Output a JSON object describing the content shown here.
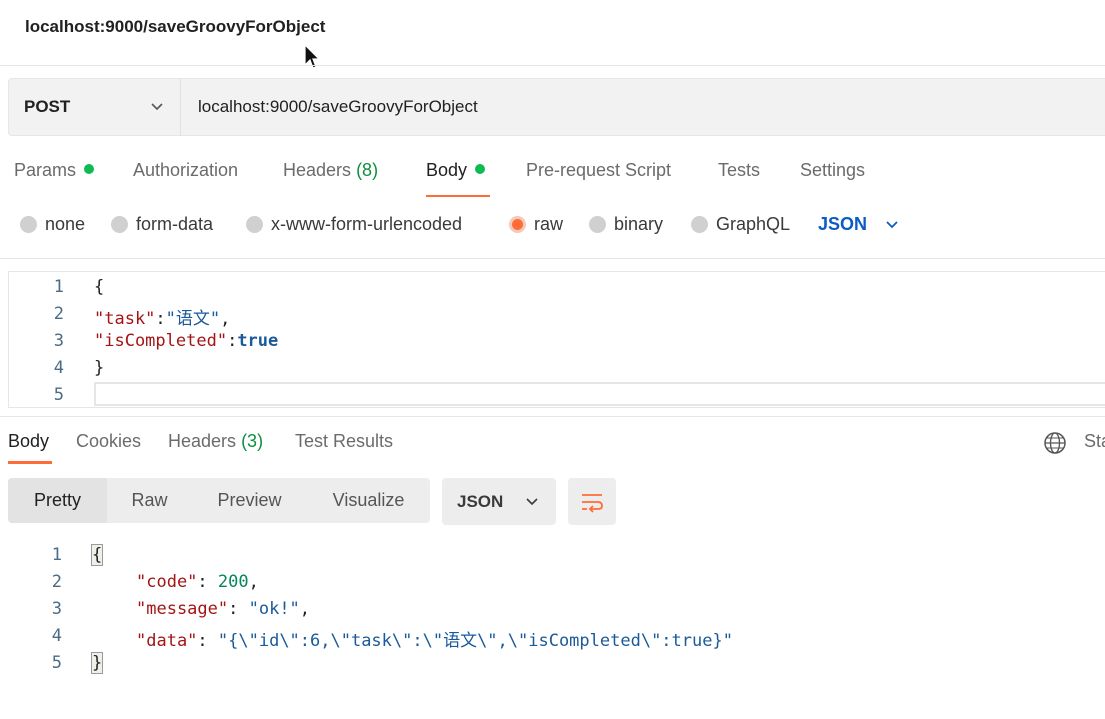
{
  "page_title": "localhost:9000/saveGroovyForObject",
  "request": {
    "method": "POST",
    "url": "localhost:9000/saveGroovyForObject"
  },
  "request_tabs": [
    {
      "label": "Params"
    },
    {
      "label": "Authorization"
    },
    {
      "label": "Headers",
      "count": "(8)"
    },
    {
      "label": "Body"
    },
    {
      "label": "Pre-request Script"
    },
    {
      "label": "Tests"
    },
    {
      "label": "Settings"
    }
  ],
  "body_types": [
    "none",
    "form-data",
    "x-www-form-urlencoded",
    "raw",
    "binary",
    "GraphQL"
  ],
  "body_format": "JSON",
  "request_body": {
    "line_numbers": [
      "1",
      "2",
      "3",
      "4",
      "5"
    ],
    "open": "{",
    "k1": "\"task\"",
    "c1": ":",
    "v1": "\"语文\"",
    "comma1": ",",
    "k2": "\"isCompleted\"",
    "c2": ":",
    "v2": "true",
    "close": "}"
  },
  "response_tabs": [
    {
      "label": "Body"
    },
    {
      "label": "Cookies"
    },
    {
      "label": "Headers",
      "count": "(3)"
    },
    {
      "label": "Test Results"
    }
  ],
  "status_partial": "Sta",
  "view_modes": [
    "Pretty",
    "Raw",
    "Preview",
    "Visualize"
  ],
  "response_format": "JSON",
  "response_body": {
    "line_numbers": [
      "1",
      "2",
      "3",
      "4",
      "5"
    ],
    "open": "{",
    "k1": "\"code\"",
    "c1": ": ",
    "v1": "200",
    "comma1": ",",
    "k2": "\"message\"",
    "c2": ": ",
    "v2": "\"ok!\"",
    "comma2": ",",
    "k3": "\"data\"",
    "c3": ": ",
    "v3": "\"{\\\"id\\\":6,\\\"task\\\":\\\"语文\\\",\\\"isCompleted\\\":true}\"",
    "close": "}"
  },
  "colors": {
    "accent": "#ff6c37",
    "green_dot": "#0cbb52",
    "link_blue": "#0b5cc4"
  }
}
